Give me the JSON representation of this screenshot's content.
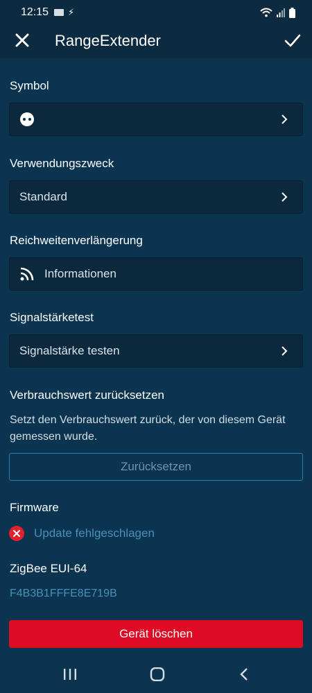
{
  "status_bar": {
    "time": "12:15"
  },
  "app_bar": {
    "title": "RangeExtender"
  },
  "sections": {
    "symbol": {
      "label": "Symbol"
    },
    "usage": {
      "label": "Verwendungszweck",
      "value": "Standard"
    },
    "range": {
      "label": "Reichweitenverlängerung",
      "value": "Informationen"
    },
    "signal": {
      "label": "Signalstärketest",
      "value": "Signalstärke testen"
    },
    "reset": {
      "label": "Verbrauchswert zurücksetzen",
      "description": "Setzt den Verbrauchswert zurück, der von diesem Gerät gemessen wurde.",
      "button": "Zurücksetzen"
    },
    "firmware": {
      "label": "Firmware",
      "status": "Update fehlgeschlagen"
    },
    "zigbee": {
      "label": "ZigBee EUI-64",
      "value": "F4B3B1FFFE8E719B"
    }
  },
  "delete_button": "Gerät löschen",
  "colors": {
    "background": "#0a3450",
    "header": "#0c2b40",
    "row": "#0b283d",
    "accent_link": "#4a8fb5",
    "error": "#e4202e",
    "delete": "#dd0b24"
  },
  "icons": {
    "symbol": "socket-icon",
    "range": "wifi-signal-icon",
    "firmware_status": "error-x-icon",
    "close": "close-icon",
    "confirm": "check-icon"
  }
}
